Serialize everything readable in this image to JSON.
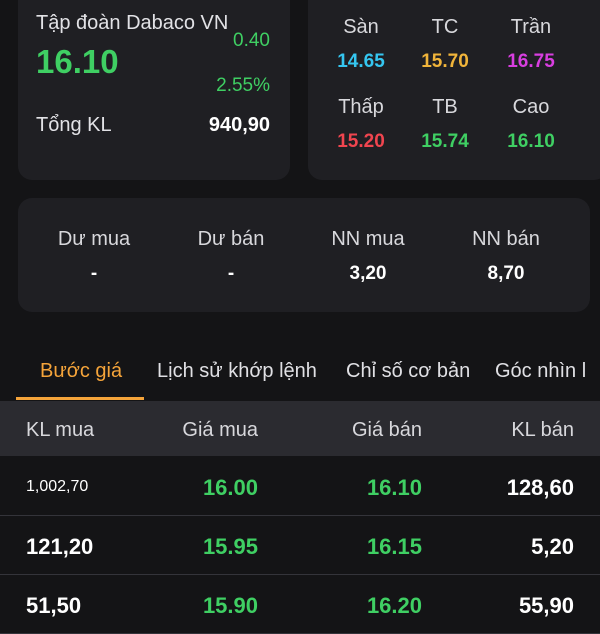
{
  "quote": {
    "company": "Tập đoàn Dabaco VN",
    "last_price": "16.10",
    "change": "0.40",
    "change_pct": "2.55%",
    "total_volume_label": "Tổng KL",
    "total_volume": "940,90"
  },
  "prices": [
    {
      "label": "Sàn",
      "value": "14.65",
      "color": "#35c6f0"
    },
    {
      "label": "TC",
      "value": "15.70",
      "color": "#f0b43a"
    },
    {
      "label": "Trần",
      "value": "16.75",
      "color": "#d83ee0"
    },
    {
      "label": "Thấp",
      "value": "15.20",
      "color": "#f0454f"
    },
    {
      "label": "TB",
      "value": "15.74",
      "color": "#3fcf63"
    },
    {
      "label": "Cao",
      "value": "16.10",
      "color": "#3fcf63"
    }
  ],
  "flow": [
    {
      "label": "Dư mua",
      "value": "-"
    },
    {
      "label": "Dư bán",
      "value": "-"
    },
    {
      "label": "NN mua",
      "value": "3,20"
    },
    {
      "label": "NN bán",
      "value": "8,70"
    }
  ],
  "tabs": [
    {
      "label": "Bước giá",
      "active": true
    },
    {
      "label": "Lịch sử khớp lệnh",
      "active": false
    },
    {
      "label": "Chỉ số cơ bản",
      "active": false
    },
    {
      "label": "Góc nhìn l",
      "active": false
    }
  ],
  "table": {
    "headers": [
      "KL mua",
      "Giá mua",
      "Giá bán",
      "KL bán"
    ],
    "rows": [
      {
        "bid_vol": "1,002,70",
        "bid": "16.00",
        "ask": "16.10",
        "ask_vol": "128,60"
      },
      {
        "bid_vol": "121,20",
        "bid": "15.95",
        "ask": "16.15",
        "ask_vol": "5,20"
      },
      {
        "bid_vol": "51,50",
        "bid": "15.90",
        "ask": "16.20",
        "ask_vol": "55,90"
      }
    ]
  },
  "colors": {
    "background": "#141416",
    "card": "#1f1f23",
    "up": "#3fcf63",
    "accent": "#f5a43a",
    "header_bg": "#2b2b30"
  }
}
